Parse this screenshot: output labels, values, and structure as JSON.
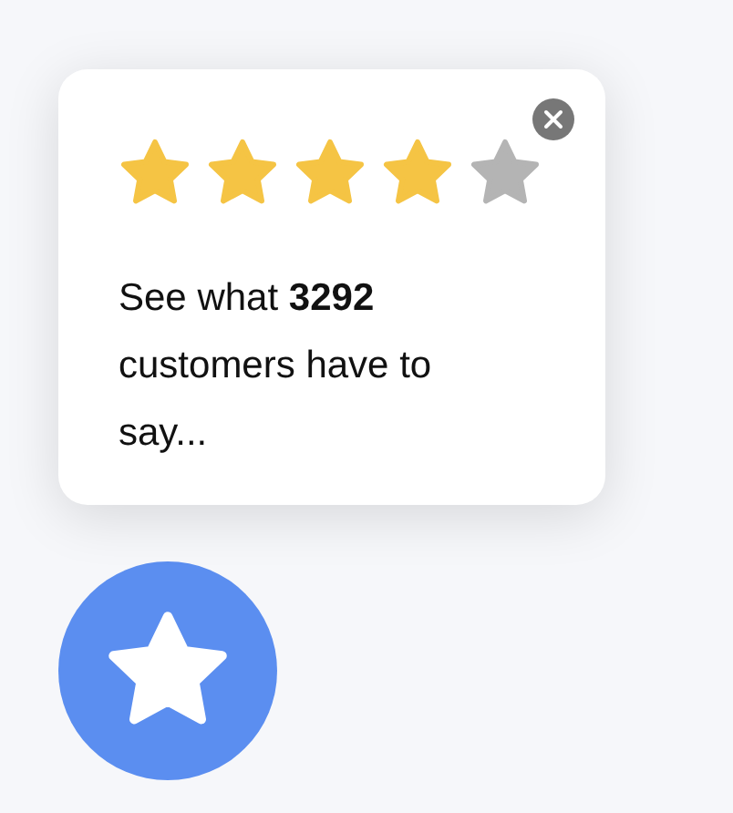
{
  "rating": {
    "stars": 4
  },
  "message": "See what **3292** customers have to say..."
}
